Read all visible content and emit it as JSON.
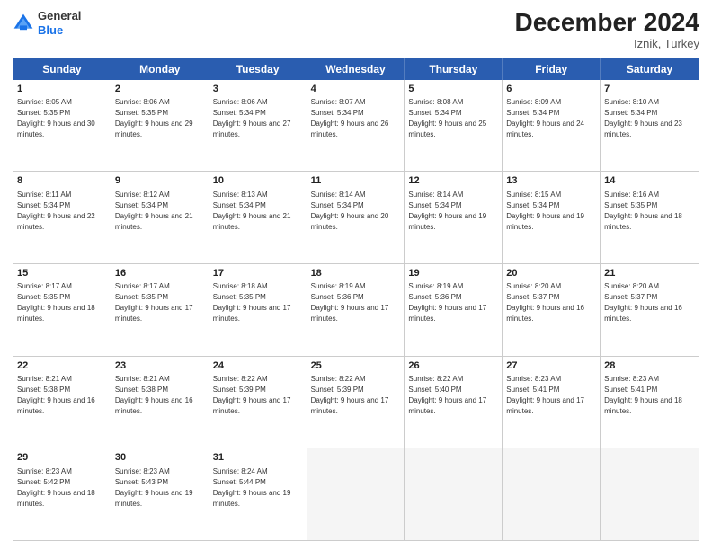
{
  "logo": {
    "general": "General",
    "blue": "Blue"
  },
  "title": "December 2024",
  "subtitle": "Iznik, Turkey",
  "days": [
    "Sunday",
    "Monday",
    "Tuesday",
    "Wednesday",
    "Thursday",
    "Friday",
    "Saturday"
  ],
  "rows": [
    [
      {
        "day": "1",
        "sunrise": "8:05 AM",
        "sunset": "5:35 PM",
        "daylight": "9 hours and 30 minutes."
      },
      {
        "day": "2",
        "sunrise": "8:06 AM",
        "sunset": "5:35 PM",
        "daylight": "9 hours and 29 minutes."
      },
      {
        "day": "3",
        "sunrise": "8:06 AM",
        "sunset": "5:34 PM",
        "daylight": "9 hours and 27 minutes."
      },
      {
        "day": "4",
        "sunrise": "8:07 AM",
        "sunset": "5:34 PM",
        "daylight": "9 hours and 26 minutes."
      },
      {
        "day": "5",
        "sunrise": "8:08 AM",
        "sunset": "5:34 PM",
        "daylight": "9 hours and 25 minutes."
      },
      {
        "day": "6",
        "sunrise": "8:09 AM",
        "sunset": "5:34 PM",
        "daylight": "9 hours and 24 minutes."
      },
      {
        "day": "7",
        "sunrise": "8:10 AM",
        "sunset": "5:34 PM",
        "daylight": "9 hours and 23 minutes."
      }
    ],
    [
      {
        "day": "8",
        "sunrise": "8:11 AM",
        "sunset": "5:34 PM",
        "daylight": "9 hours and 22 minutes."
      },
      {
        "day": "9",
        "sunrise": "8:12 AM",
        "sunset": "5:34 PM",
        "daylight": "9 hours and 21 minutes."
      },
      {
        "day": "10",
        "sunrise": "8:13 AM",
        "sunset": "5:34 PM",
        "daylight": "9 hours and 21 minutes."
      },
      {
        "day": "11",
        "sunrise": "8:14 AM",
        "sunset": "5:34 PM",
        "daylight": "9 hours and 20 minutes."
      },
      {
        "day": "12",
        "sunrise": "8:14 AM",
        "sunset": "5:34 PM",
        "daylight": "9 hours and 19 minutes."
      },
      {
        "day": "13",
        "sunrise": "8:15 AM",
        "sunset": "5:34 PM",
        "daylight": "9 hours and 19 minutes."
      },
      {
        "day": "14",
        "sunrise": "8:16 AM",
        "sunset": "5:35 PM",
        "daylight": "9 hours and 18 minutes."
      }
    ],
    [
      {
        "day": "15",
        "sunrise": "8:17 AM",
        "sunset": "5:35 PM",
        "daylight": "9 hours and 18 minutes."
      },
      {
        "day": "16",
        "sunrise": "8:17 AM",
        "sunset": "5:35 PM",
        "daylight": "9 hours and 17 minutes."
      },
      {
        "day": "17",
        "sunrise": "8:18 AM",
        "sunset": "5:35 PM",
        "daylight": "9 hours and 17 minutes."
      },
      {
        "day": "18",
        "sunrise": "8:19 AM",
        "sunset": "5:36 PM",
        "daylight": "9 hours and 17 minutes."
      },
      {
        "day": "19",
        "sunrise": "8:19 AM",
        "sunset": "5:36 PM",
        "daylight": "9 hours and 17 minutes."
      },
      {
        "day": "20",
        "sunrise": "8:20 AM",
        "sunset": "5:37 PM",
        "daylight": "9 hours and 16 minutes."
      },
      {
        "day": "21",
        "sunrise": "8:20 AM",
        "sunset": "5:37 PM",
        "daylight": "9 hours and 16 minutes."
      }
    ],
    [
      {
        "day": "22",
        "sunrise": "8:21 AM",
        "sunset": "5:38 PM",
        "daylight": "9 hours and 16 minutes."
      },
      {
        "day": "23",
        "sunrise": "8:21 AM",
        "sunset": "5:38 PM",
        "daylight": "9 hours and 16 minutes."
      },
      {
        "day": "24",
        "sunrise": "8:22 AM",
        "sunset": "5:39 PM",
        "daylight": "9 hours and 17 minutes."
      },
      {
        "day": "25",
        "sunrise": "8:22 AM",
        "sunset": "5:39 PM",
        "daylight": "9 hours and 17 minutes."
      },
      {
        "day": "26",
        "sunrise": "8:22 AM",
        "sunset": "5:40 PM",
        "daylight": "9 hours and 17 minutes."
      },
      {
        "day": "27",
        "sunrise": "8:23 AM",
        "sunset": "5:41 PM",
        "daylight": "9 hours and 17 minutes."
      },
      {
        "day": "28",
        "sunrise": "8:23 AM",
        "sunset": "5:41 PM",
        "daylight": "9 hours and 18 minutes."
      }
    ],
    [
      {
        "day": "29",
        "sunrise": "8:23 AM",
        "sunset": "5:42 PM",
        "daylight": "9 hours and 18 minutes."
      },
      {
        "day": "30",
        "sunrise": "8:23 AM",
        "sunset": "5:43 PM",
        "daylight": "9 hours and 19 minutes."
      },
      {
        "day": "31",
        "sunrise": "8:24 AM",
        "sunset": "5:44 PM",
        "daylight": "9 hours and 19 minutes."
      },
      null,
      null,
      null,
      null
    ]
  ]
}
